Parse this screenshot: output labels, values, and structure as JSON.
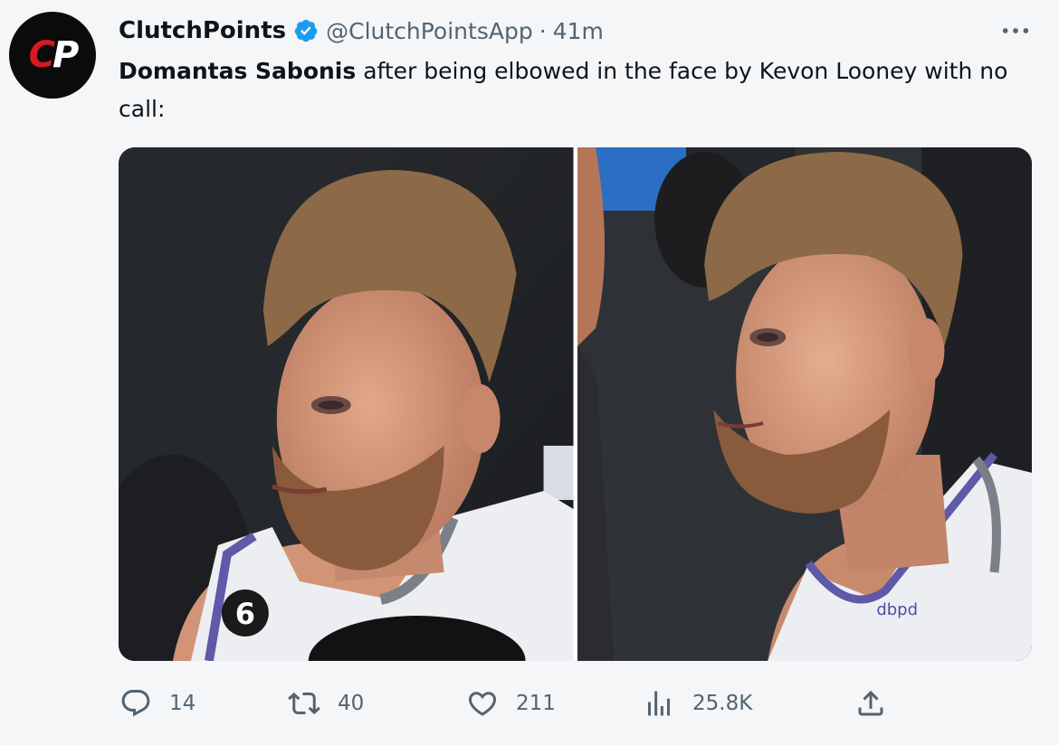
{
  "author": {
    "display_name": "ClutchPoints",
    "handle": "@ClutchPointsApp",
    "separator": "·",
    "time": "41m",
    "avatar_letters": {
      "c": "C",
      "p": "P"
    }
  },
  "tweet": {
    "mention": "Domantas Sabonis",
    "text": " after being elbowed in the face by Kevon Looney with no call:"
  },
  "media": {
    "photos": [
      {
        "jersey_number": "6"
      },
      {
        "jersey_sponsor": "dbpd"
      }
    ]
  },
  "actions": {
    "replies": "14",
    "retweets": "40",
    "likes": "211",
    "views": "25.8K"
  },
  "colors": {
    "accent": "#1d9bf0",
    "muted": "#536471",
    "text": "#0f1419",
    "brand_red": "#d71920"
  },
  "icons": [
    "verified-badge-icon",
    "more-icon",
    "reply-icon",
    "retweet-icon",
    "like-icon",
    "views-icon",
    "share-icon"
  ]
}
